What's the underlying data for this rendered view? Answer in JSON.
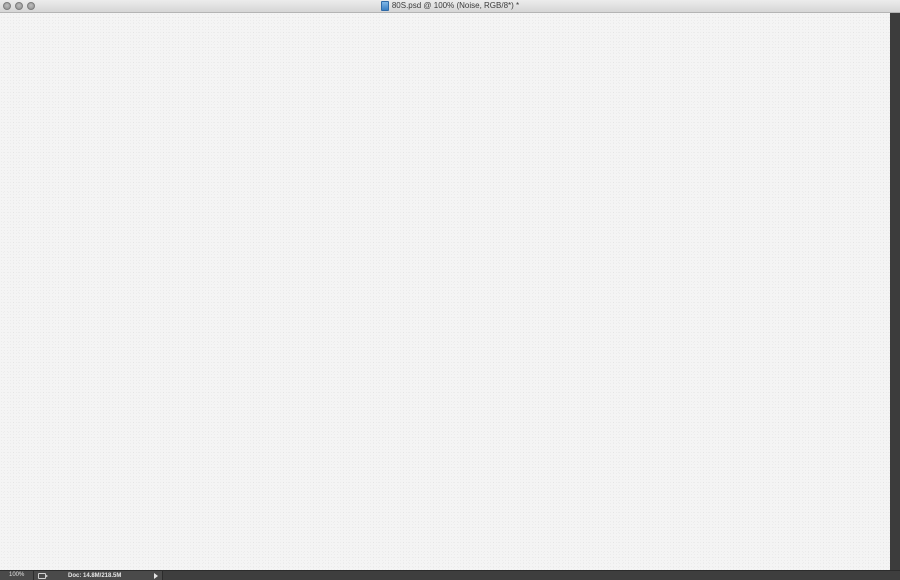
{
  "window": {
    "title": "80S.psd @ 100% (Noise, RGB/8*) *"
  },
  "statusbar": {
    "zoom": "100%",
    "doc_info": "Doc: 14.8M/218.5M"
  },
  "colors": {
    "canvas": "#f4f4f4",
    "chrome_dark": "#3a3a3a",
    "titlebar": "#e2e2e2"
  },
  "icons": {
    "document": "psd-file-icon",
    "export": "export-icon",
    "status_menu": "play-arrow-icon"
  }
}
